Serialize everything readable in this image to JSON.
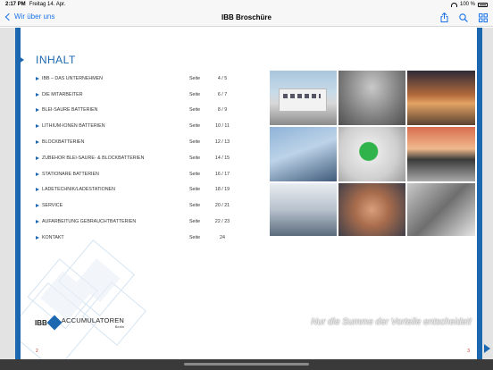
{
  "status_bar": {
    "time": "2:17 PM",
    "date": "Freitag 14. Apr.",
    "battery": "100 %",
    "icons": [
      "wifi-icon",
      "battery-icon"
    ]
  },
  "nav": {
    "back_label": "Wir über uns",
    "title": "IBB Broschüre",
    "actions": [
      "share-icon",
      "search-icon",
      "grid-icon"
    ]
  },
  "page": {
    "heading": "INHALT",
    "toc": [
      {
        "label": "IBB – DAS UNTERNEHMEN",
        "seite": "Seite",
        "pages": "4 / 5"
      },
      {
        "label": "DIE MITARBEITER",
        "seite": "Seite",
        "pages": "6 / 7"
      },
      {
        "label": "BLEI-SÄURE BATTERIEN",
        "seite": "Seite",
        "pages": "8 / 9"
      },
      {
        "label": "LITHIUM-IONEN BATTERIEN",
        "seite": "Seite",
        "pages": "10 / 11"
      },
      {
        "label": "BLOCKBATTERIEN",
        "seite": "Seite",
        "pages": "12 / 13"
      },
      {
        "label": "ZUBEHÖR BLEI-SÄURE- & BLOCKBATTERIEN",
        "seite": "Seite",
        "pages": "14 / 15"
      },
      {
        "label": "STATIONÄRE BATTERIEN",
        "seite": "Seite",
        "pages": "16 / 17"
      },
      {
        "label": "LADETECHNIK/LADESTATIONEN",
        "seite": "Seite",
        "pages": "18 / 19"
      },
      {
        "label": "SERVICE",
        "seite": "Seite",
        "pages": "20 / 21"
      },
      {
        "label": "AUFARBEITUNG GEBRAUCHTBATTERIEN",
        "seite": "Seite",
        "pages": "22 / 23"
      },
      {
        "label": "KONTAKT",
        "seite": "Seite",
        "pages": "24"
      }
    ],
    "photos": [
      "building-photo",
      "runner-photo",
      "runner-sunset-photo",
      "climber-photo",
      "plug-photo",
      "pylon-photo",
      "chargers-photo",
      "hands-photo",
      "battery-cells-photo"
    ],
    "logo": {
      "ibb": "IBB",
      "name": "ACCUMULATOREN",
      "city": "Berlin"
    },
    "slogan": "Nur die Summe der Vorteile entscheidet!",
    "page_left": "2",
    "page_right": "3"
  },
  "colors": {
    "accent": "#1c68b0",
    "link": "#1a73e8"
  }
}
